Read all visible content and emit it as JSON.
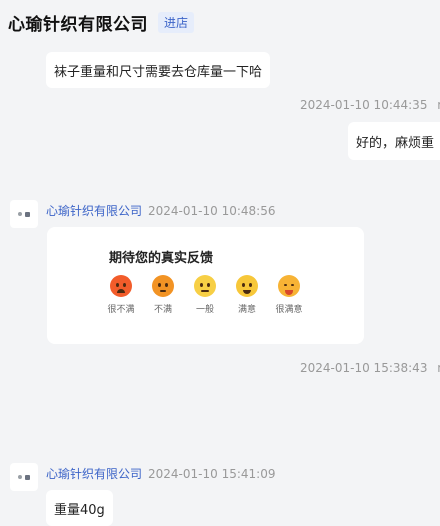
{
  "header": {
    "shop_name": "心瑜针织有限公司",
    "enter_label": "进店"
  },
  "messages": {
    "m1_text": "袜子重量和尺寸需要去仓库量一下哈",
    "m2_time": "2024-01-10 10:44:35",
    "m2_name_fragment": "ma",
    "m2_text": "好的，麻烦重",
    "m3_sender": "心瑜针织有限公司",
    "m3_time": "2024-01-10 10:48:56",
    "m4_time": "2024-01-10 15:38:43",
    "m4_name_fragment": "ma",
    "m5_sender": "心瑜针织有限公司",
    "m5_time": "2024-01-10 15:41:09",
    "m5_text": "重量40g"
  },
  "feedback_card": {
    "title": "期待您的真实反馈",
    "options": [
      {
        "label": "很不满",
        "icon": "very-unsatisfied-face-icon",
        "color": "#f25c2a"
      },
      {
        "label": "不满",
        "icon": "unsatisfied-face-icon",
        "color": "#f29324"
      },
      {
        "label": "一般",
        "icon": "neutral-face-icon",
        "color": "#f7cf45"
      },
      {
        "label": "满意",
        "icon": "satisfied-face-icon",
        "color": "#f7c739"
      },
      {
        "label": "很满意",
        "icon": "very-satisfied-face-icon",
        "color": "#f7b335"
      }
    ]
  }
}
